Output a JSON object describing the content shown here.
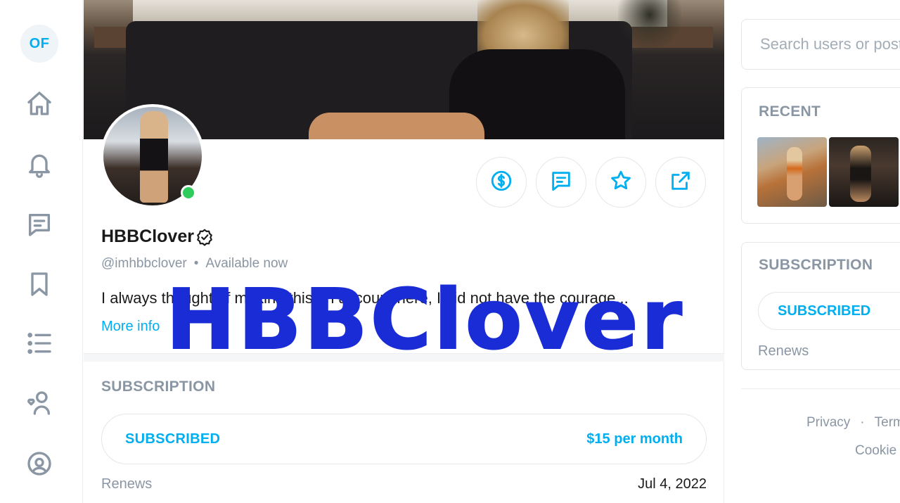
{
  "nav": {
    "logo_text": "OF",
    "items": [
      {
        "icon": "home-icon"
      },
      {
        "icon": "bell-icon"
      },
      {
        "icon": "messages-icon"
      },
      {
        "icon": "bookmark-icon"
      },
      {
        "icon": "lists-icon"
      },
      {
        "icon": "subscriptions-icon"
      },
      {
        "icon": "profile-icon"
      }
    ]
  },
  "profile": {
    "name": "HBBClover",
    "verified": true,
    "handle": "@imhbbclover",
    "separator": "•",
    "status": "Available now",
    "bio": "I always thought of making this an account here, I did not have the courage...",
    "more_info": "More info",
    "actions": [
      "tip-icon",
      "message-icon",
      "favorite-icon",
      "share-icon"
    ]
  },
  "subscription": {
    "heading": "SUBSCRIPTION",
    "status_label": "SUBSCRIBED",
    "price": "$15 per month",
    "renews_label": "Renews",
    "renews_date": "Jul 4, 2022"
  },
  "watermark": "HBBClover",
  "sidebar": {
    "search_placeholder": "Search users or posts",
    "recent_title": "RECENT",
    "subscription_title": "SUBSCRIPTION",
    "subscribed_label": "SUBSCRIBED",
    "renews_label": "Renews",
    "footer": {
      "privacy": "Privacy",
      "dot": "·",
      "terms": "Terms",
      "cookie": "Cookie"
    }
  },
  "colors": {
    "accent": "#00aff0",
    "muted": "#8a96a3",
    "online": "#2ecc5a",
    "watermark": "#1a2cd6"
  }
}
